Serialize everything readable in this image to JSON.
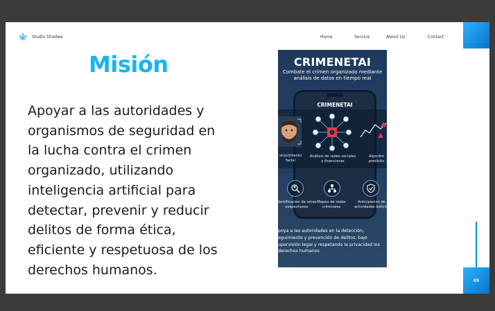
{
  "brand": {
    "name": "Studio Shodwe",
    "logo_icon": "lotus-icon"
  },
  "nav": [
    "Home",
    "Service",
    "About Us",
    "Contact"
  ],
  "title": "Misión",
  "body": "Apoyar a las autoridades y organismos de seguridad en la lucha contra el crimen organizado, utilizando inteligencia artificial para detectar, prevenir y reducir delitos de forma ética, eficiente y respetuosa de los derechos humanos.",
  "page_number": "05",
  "infographic": {
    "title": "CRIMENETAI",
    "subtitle": "Combate el crimen organizado mediante análisis de datos en tiempo real",
    "phone_title": "CRIMENETAI",
    "labels": {
      "face": "onocimiento facial",
      "network": "Análisis de redes sociales y financieras",
      "algorithm": "Algoritm predictiv",
      "identification": "dentificación de omes sospechosos",
      "map": "Mapeo de redes criminales",
      "anticipation": "Anticipación de actividades delictiv"
    },
    "footer": "poya a las autoridades en la detección, eguimiento y prevención de delitos, bajo upervisión legal y respetando la privacidad los derechos humanos"
  },
  "colors": {
    "accent": "#16b5f2",
    "accent_dark": "#0a72c9",
    "infographic_bg": "#243f61"
  }
}
